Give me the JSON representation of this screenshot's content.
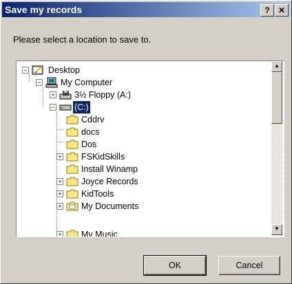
{
  "window": {
    "title": "Save my records",
    "help_glyph": "?",
    "close_glyph": "✕"
  },
  "prompt": "Please select a location to save to.",
  "tree": [
    {
      "label": "Desktop",
      "icon": "desktop-icon",
      "expander": "−"
    },
    {
      "label": "My Computer",
      "icon": "computer-icon",
      "expander": "−"
    },
    {
      "label": "3½ Floppy (A:)",
      "icon": "floppy-drive-icon",
      "expander": "+"
    },
    {
      "label": "(C:)",
      "icon": "hard-drive-icon",
      "expander": "−",
      "selected": true
    },
    {
      "label": "Cddrv",
      "icon": "folder-icon"
    },
    {
      "label": "docs",
      "icon": "folder-icon"
    },
    {
      "label": "Dos",
      "icon": "folder-icon"
    },
    {
      "label": "FSKidSkills",
      "icon": "folder-icon",
      "expander": "+"
    },
    {
      "label": "Install Winamp",
      "icon": "folder-icon"
    },
    {
      "label": "Joyce Records",
      "icon": "folder-icon",
      "expander": "+"
    },
    {
      "label": "KidTools",
      "icon": "folder-icon",
      "expander": "+"
    },
    {
      "label": "My Documents",
      "icon": "my-documents-folder-icon",
      "expander": "+"
    },
    {
      "label": "My Music",
      "icon": "folder-icon",
      "expander": "+"
    }
  ],
  "scroll": {
    "up_glyph": "▲",
    "down_glyph": "▼"
  },
  "buttons": {
    "ok": "OK",
    "cancel": "Cancel"
  }
}
